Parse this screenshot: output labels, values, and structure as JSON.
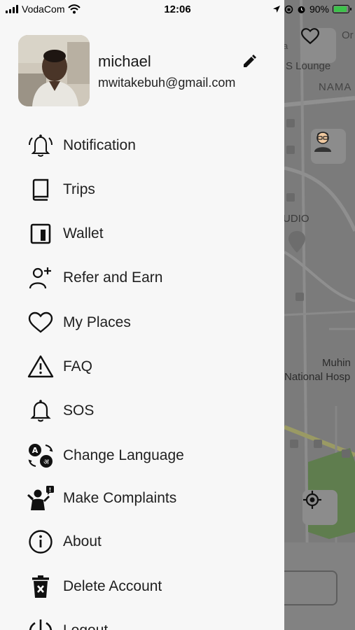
{
  "status_bar": {
    "carrier": "VodaCom",
    "time": "12:06",
    "battery_percent": "90%",
    "battery_level": 0.9
  },
  "profile": {
    "name": "michael",
    "email": "mwitakebuh@gmail.com"
  },
  "menu": [
    {
      "label": "Notification",
      "icon": "bell-ringing-icon"
    },
    {
      "label": "Trips",
      "icon": "book-icon"
    },
    {
      "label": "Wallet",
      "icon": "wallet-icon"
    },
    {
      "label": "Refer and Earn",
      "icon": "user-add-icon"
    },
    {
      "label": "My Places",
      "icon": "heart-icon"
    },
    {
      "label": "FAQ",
      "icon": "warning-icon"
    },
    {
      "label": "SOS",
      "icon": "bell-icon"
    },
    {
      "label": "Change Language",
      "icon": "translate-icon"
    },
    {
      "label": "Make Complaints",
      "icon": "complaint-icon"
    },
    {
      "label": "About",
      "icon": "info-icon"
    },
    {
      "label": "Delete Account",
      "icon": "trash-icon"
    },
    {
      "label": "Logout",
      "icon": "power-icon"
    }
  ],
  "map": {
    "labels": [
      "S Lounge",
      "NAMA",
      "UDIO",
      "Muhin",
      "National Hosp",
      "Or",
      "a"
    ]
  },
  "colors": {
    "drawer_bg": "#f7f7f7",
    "map_bg": "#7d7d7d",
    "text": "#1f1f1f",
    "battery": "#3cc24a"
  }
}
